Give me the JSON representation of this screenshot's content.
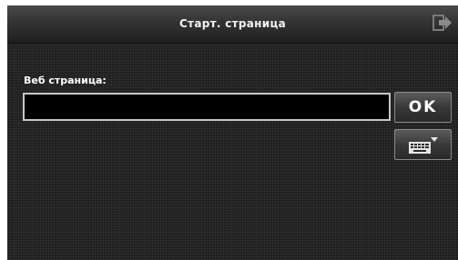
{
  "header": {
    "title": "Старт. страница",
    "exit_icon": "exit-arrow-icon"
  },
  "form": {
    "label": "Веб страница:",
    "url_value": "",
    "ok_label": "OK",
    "keyboard_icon": "keyboard-icon"
  }
}
